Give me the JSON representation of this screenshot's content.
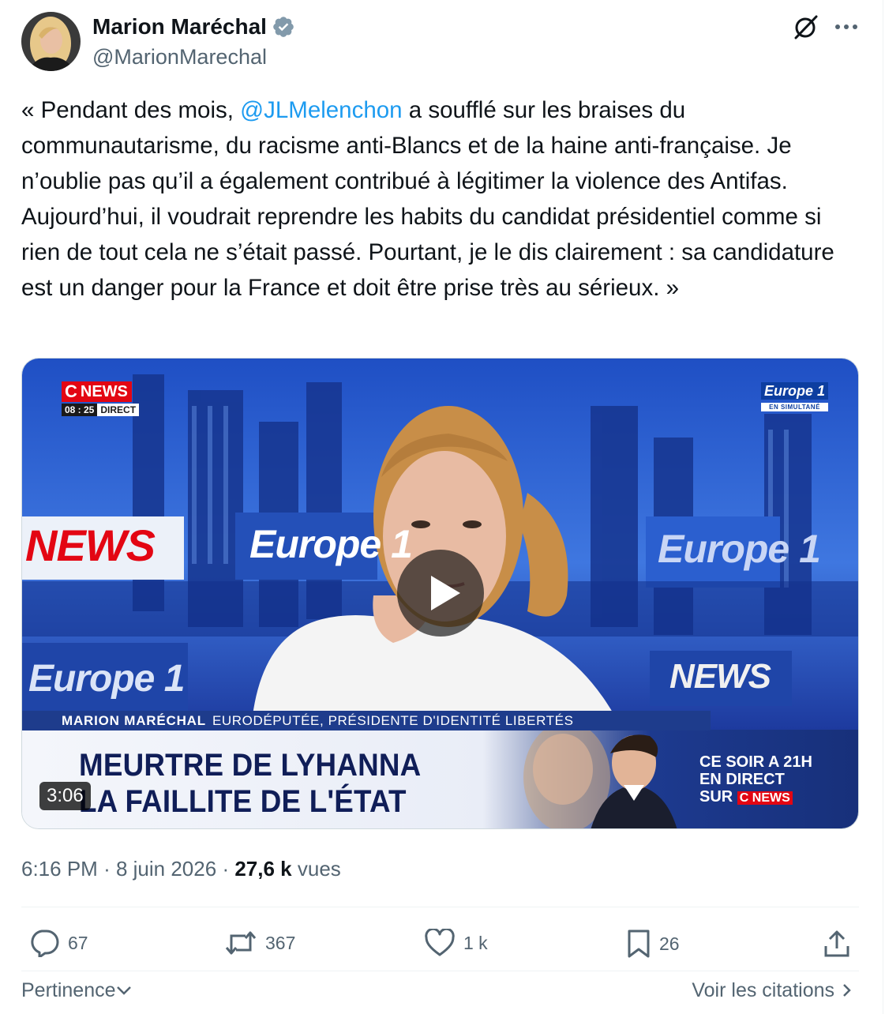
{
  "author": {
    "display_name": "Marion Maréchal",
    "handle": "@MarionMarechal",
    "verified_icon": "verified-badge-icon",
    "avatar_icon": "avatar"
  },
  "header_actions": {
    "grok_icon": "grok-icon",
    "more_icon": "more-dots-icon"
  },
  "tweet": {
    "text_before": "« Pendant des mois, ",
    "mention": "@JLMelenchon",
    "text_after": " a soufflé sur les braises du communautarisme, du racisme anti-Blancs et de la haine anti-française. Je n’oublie pas qu’il a également contribué à légitimer la violence des Antifas. Aujourd’hui, il voudrait reprendre les habits du candidat présidentiel comme si rien de tout cela ne s’était passé. Pourtant, je le dis clairement : sa candidature est un danger pour la France et doit être prise très au sérieux. »"
  },
  "media": {
    "duration": "3:06",
    "play_icon": "play-icon",
    "broadcast": {
      "cnews_c": "C",
      "cnews_news": "NEWS",
      "clock": "08 : 25",
      "live": "DIRECT",
      "europe1": "Europe 1",
      "simulcast": "EN SIMULTANÉ",
      "bg_sign_cnews_left": "NEWS",
      "bg_sign_europe_center": "Europe 1",
      "bg_sign_europe_right": "Europe 1",
      "bg_sign_europe_left": "Europe 1",
      "bg_sign_cnews_right": "NEWS",
      "lower_name": "MARION MARÉCHAL",
      "lower_title": "EURODÉPUTÉE, PRÉSIDENTE D'IDENTITÉ LIBERTÉS",
      "headline_1": "MEURTRE DE LYHANNA",
      "headline_2": "LA FAILLITE DE L'ÉTAT",
      "promo_1": "CE SOIR A 21H",
      "promo_2": "EN DIRECT",
      "promo_3": "SUR",
      "promo_badge": "C NEWS"
    }
  },
  "meta": {
    "time": "6:16 PM",
    "sep": "·",
    "date": "8 juin 2026",
    "views_count": "27,6 k",
    "views_label": "vues"
  },
  "actions": {
    "replies": "67",
    "reposts": "367",
    "likes": "1 k",
    "bookmarks": "26"
  },
  "footer": {
    "sort_label": "Pertinence",
    "quotes_label": "Voir les citations"
  }
}
